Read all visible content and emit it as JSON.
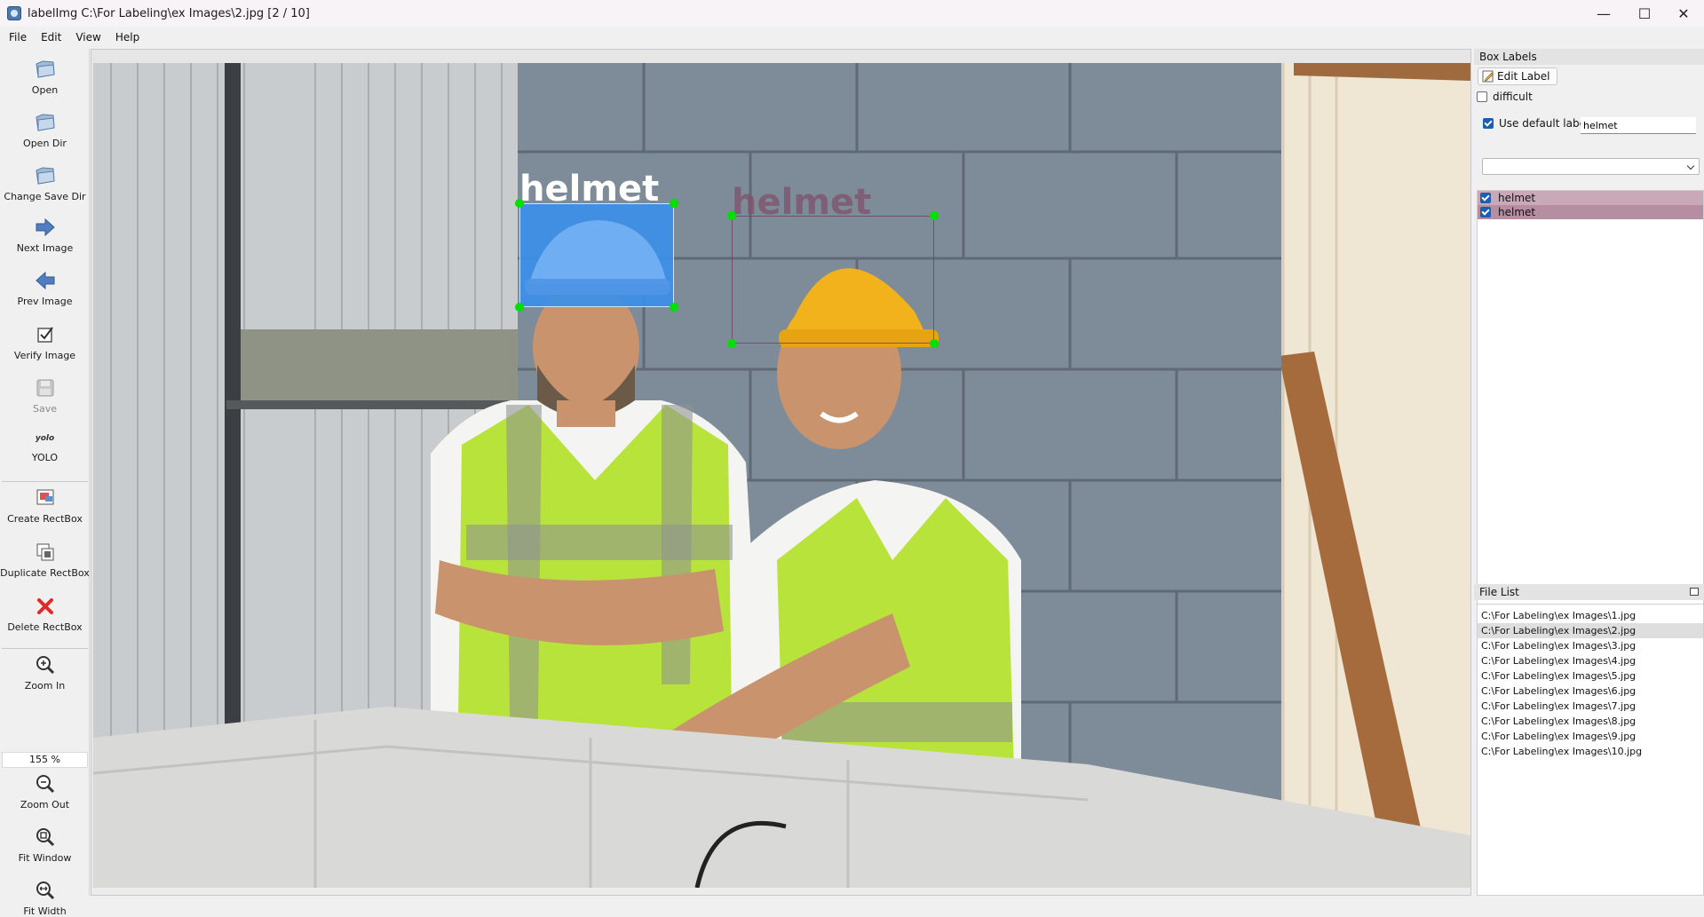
{
  "window": {
    "title": "labelImg C:\\For Labeling\\ex Images\\2.jpg [2 / 10]",
    "controls": {
      "minimize": "—",
      "maximize": "☐",
      "close": "✕"
    }
  },
  "menu": [
    "File",
    "Edit",
    "View",
    "Help"
  ],
  "toolbar": {
    "open": "Open",
    "open_dir": "Open Dir",
    "change_save_dir": "Change Save Dir",
    "next_image": "Next Image",
    "prev_image": "Prev Image",
    "verify_image": "Verify Image",
    "save": "Save",
    "format_icon_text": "yolo",
    "format": "YOLO",
    "create_rectbox": "Create RectBox",
    "duplicate_rectbox": "Duplicate RectBox",
    "delete_rectbox": "Delete RectBox",
    "zoom_in": "Zoom In",
    "zoom_value": "155 %",
    "zoom_out": "Zoom Out",
    "fit_window": "Fit Window",
    "fit_width": "Fit Width"
  },
  "canvas": {
    "boxes": [
      {
        "label": "helmet",
        "selected": true
      },
      {
        "label": "helmet",
        "selected": false
      }
    ]
  },
  "box_labels_panel": {
    "title": "Box Labels",
    "edit_label_button": "Edit Label",
    "difficult": "difficult",
    "difficult_checked": false,
    "use_default_label": "Use default label",
    "use_default_label_checked": true,
    "default_label_value": "helmet",
    "labels": [
      {
        "text": "helmet",
        "checked": true
      },
      {
        "text": "helmet",
        "checked": true
      }
    ]
  },
  "file_list_panel": {
    "title": "File List",
    "selected_index": 1,
    "files": [
      "C:\\For Labeling\\ex Images\\1.jpg",
      "C:\\For Labeling\\ex Images\\2.jpg",
      "C:\\For Labeling\\ex Images\\3.jpg",
      "C:\\For Labeling\\ex Images\\4.jpg",
      "C:\\For Labeling\\ex Images\\5.jpg",
      "C:\\For Labeling\\ex Images\\6.jpg",
      "C:\\For Labeling\\ex Images\\7.jpg",
      "C:\\For Labeling\\ex Images\\8.jpg",
      "C:\\For Labeling\\ex Images\\9.jpg",
      "C:\\For Labeling\\ex Images\\10.jpg"
    ]
  },
  "colors": {
    "selected_box_fill": "#3b8fe8",
    "handle": "#00e000",
    "label_row_bg": "#c9a9b7",
    "active_label_text": "#ffffff",
    "inactive_label_text": "#7a5a6a"
  }
}
